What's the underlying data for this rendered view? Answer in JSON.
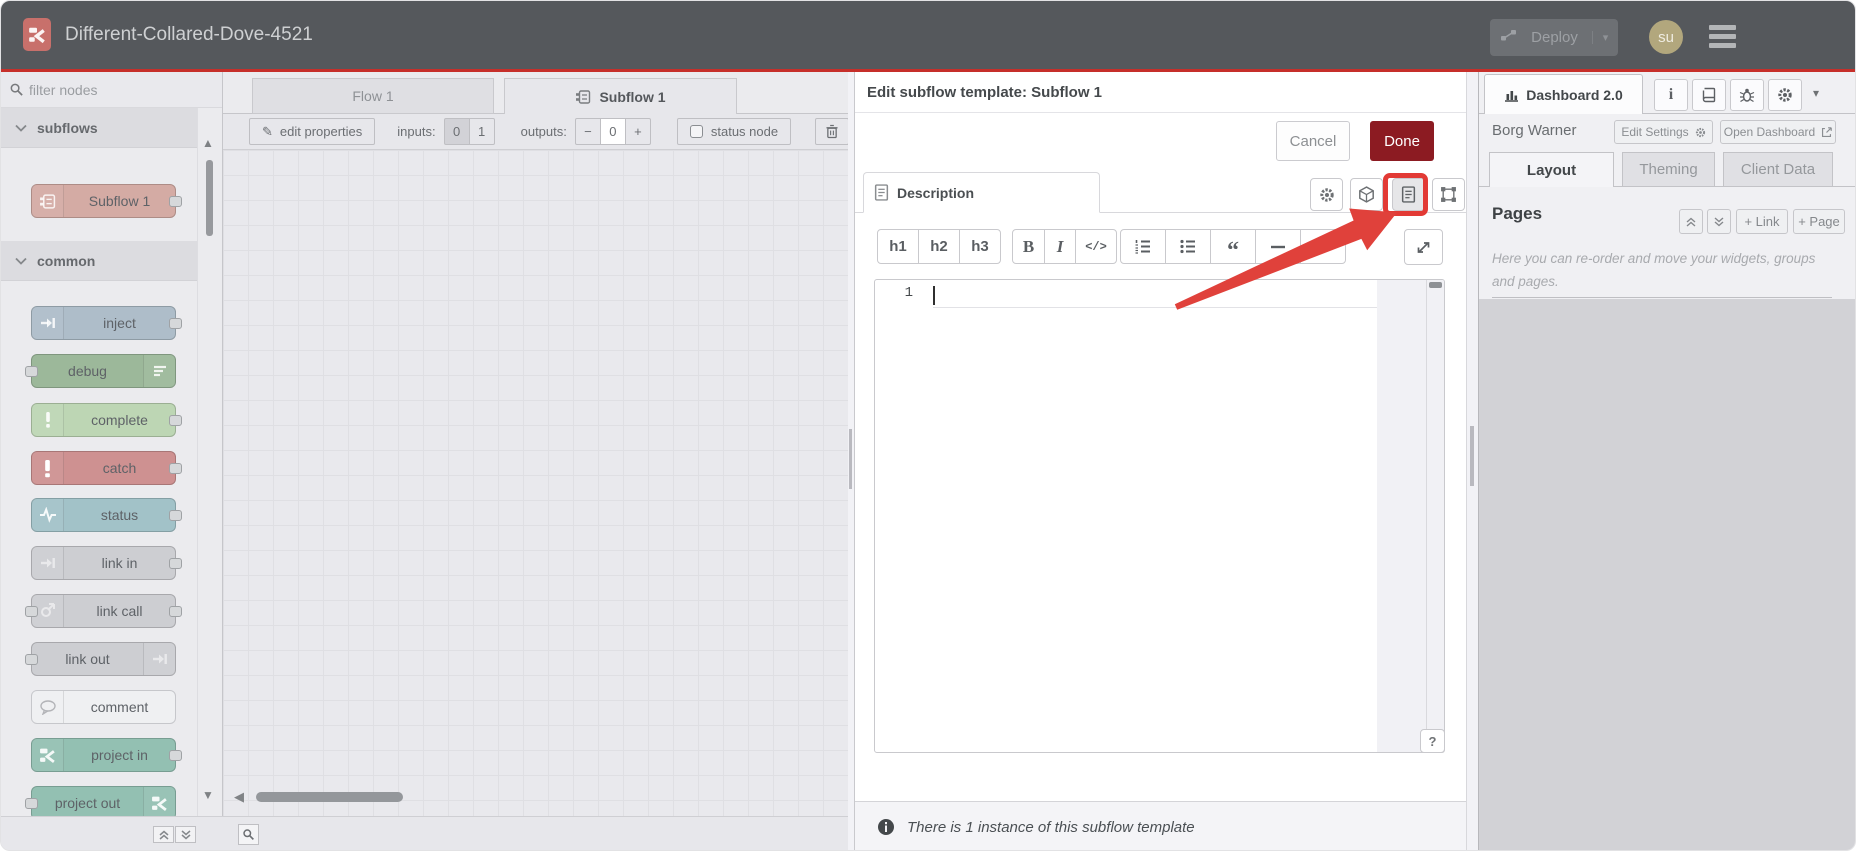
{
  "header": {
    "title": "Different-Collared-Dove-4521",
    "deploy_label": "Deploy",
    "avatar_initials": "su"
  },
  "palette": {
    "search_placeholder": "filter nodes",
    "categories": [
      {
        "label": "subflows"
      },
      {
        "label": "common"
      }
    ],
    "nodes": {
      "subflow1": {
        "label": "Subflow 1",
        "color": "#d4aba4"
      },
      "inject": {
        "label": "inject",
        "color": "#aebdc9"
      },
      "debug": {
        "label": "debug",
        "color": "#9cb89a"
      },
      "complete": {
        "label": "complete",
        "color": "#bdd6b4"
      },
      "catch": {
        "label": "catch",
        "color": "#ce9191"
      },
      "status": {
        "label": "status",
        "color": "#a2c2c8"
      },
      "link_in": {
        "label": "link in",
        "color": "#cdced2"
      },
      "link_call": {
        "label": "link call",
        "color": "#cdced2"
      },
      "link_out": {
        "label": "link out",
        "color": "#cdced2"
      },
      "comment": {
        "label": "comment",
        "color": "#eff0f2"
      },
      "project_in": {
        "label": "project in",
        "color": "#93c0b2"
      },
      "project_out": {
        "label": "project out",
        "color": "#93c0b2"
      }
    }
  },
  "workspace": {
    "tabs": [
      {
        "label": "Flow 1"
      },
      {
        "label": "Subflow 1"
      }
    ],
    "toolbar": {
      "edit_properties": "edit properties",
      "inputs_label": "inputs:",
      "input_options": [
        "0",
        "1"
      ],
      "outputs_label": "outputs:",
      "outputs_minus": "−",
      "outputs_value": "0",
      "outputs_plus": "+",
      "status_node": "status node"
    }
  },
  "dialog": {
    "title": "Edit subflow template: Subflow 1",
    "cancel_label": "Cancel",
    "done_label": "Done",
    "tab_label": "Description",
    "md_toolbar": {
      "h1": "h1",
      "h2": "h2",
      "h3": "h3",
      "bold": "B",
      "italic": "I",
      "code": "</>"
    },
    "editor": {
      "line_number": "1"
    },
    "help_button": "?",
    "footer_text": "There is 1 instance of this subflow template"
  },
  "sidebar": {
    "tab_label": "Dashboard 2.0",
    "project_name": "Borg Warner",
    "edit_settings_label": "Edit Settings",
    "open_dashboard_label": "Open Dashboard",
    "tabs": [
      {
        "label": "Layout"
      },
      {
        "label": "Theming"
      },
      {
        "label": "Client Data"
      }
    ],
    "pages": {
      "title": "Pages",
      "add_link_label": "+ Link",
      "add_page_label": "+ Page",
      "help_text": "Here you can re-order and move your widgets, groups and pages."
    }
  },
  "colors": {
    "header_bg": "#55585c",
    "accent_red_line": "#c62f2a",
    "done_button": "#8c1b22",
    "annotation_red": "#e0413b",
    "highlight_box_red": "#e23a35"
  }
}
